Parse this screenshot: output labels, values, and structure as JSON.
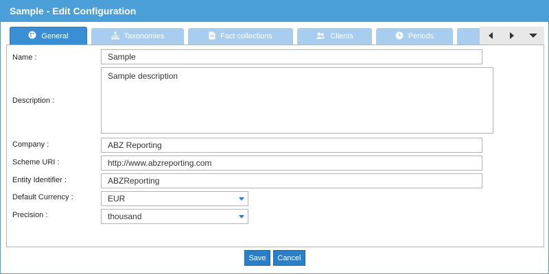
{
  "window": {
    "title": "Sample - Edit Configuration"
  },
  "tabs": [
    {
      "label": "General",
      "icon": "palette-icon",
      "active": true
    },
    {
      "label": "Taxonomies",
      "icon": "hierarchy-icon",
      "active": false
    },
    {
      "label": "Fact collections",
      "icon": "document-icon",
      "active": false
    },
    {
      "label": "Clients",
      "icon": "users-icon",
      "active": false
    },
    {
      "label": "Periods",
      "icon": "clock-icon",
      "active": false
    }
  ],
  "form": {
    "name": {
      "label": "Name :",
      "value": "Sample"
    },
    "description": {
      "label": "Description :",
      "value": "Sample description"
    },
    "company": {
      "label": "Company :",
      "value": "ABZ Reporting"
    },
    "scheme_uri": {
      "label": "Scheme URI :",
      "value": "http://www.abzreporting.com"
    },
    "entity_identifier": {
      "label": "Entity Identifier :",
      "value": "ABZReporting"
    },
    "default_currency": {
      "label": "Default Currency :",
      "value": "EUR"
    },
    "precision": {
      "label": "Precision :",
      "value": "thousand"
    }
  },
  "footer": {
    "save_label": "Save",
    "cancel_label": "Cancel"
  },
  "colors": {
    "title_bar": "#4a9fd9",
    "tab_active": "#3a8fd4",
    "tab_inactive": "#a9cdee",
    "button": "#2a7fc8"
  }
}
